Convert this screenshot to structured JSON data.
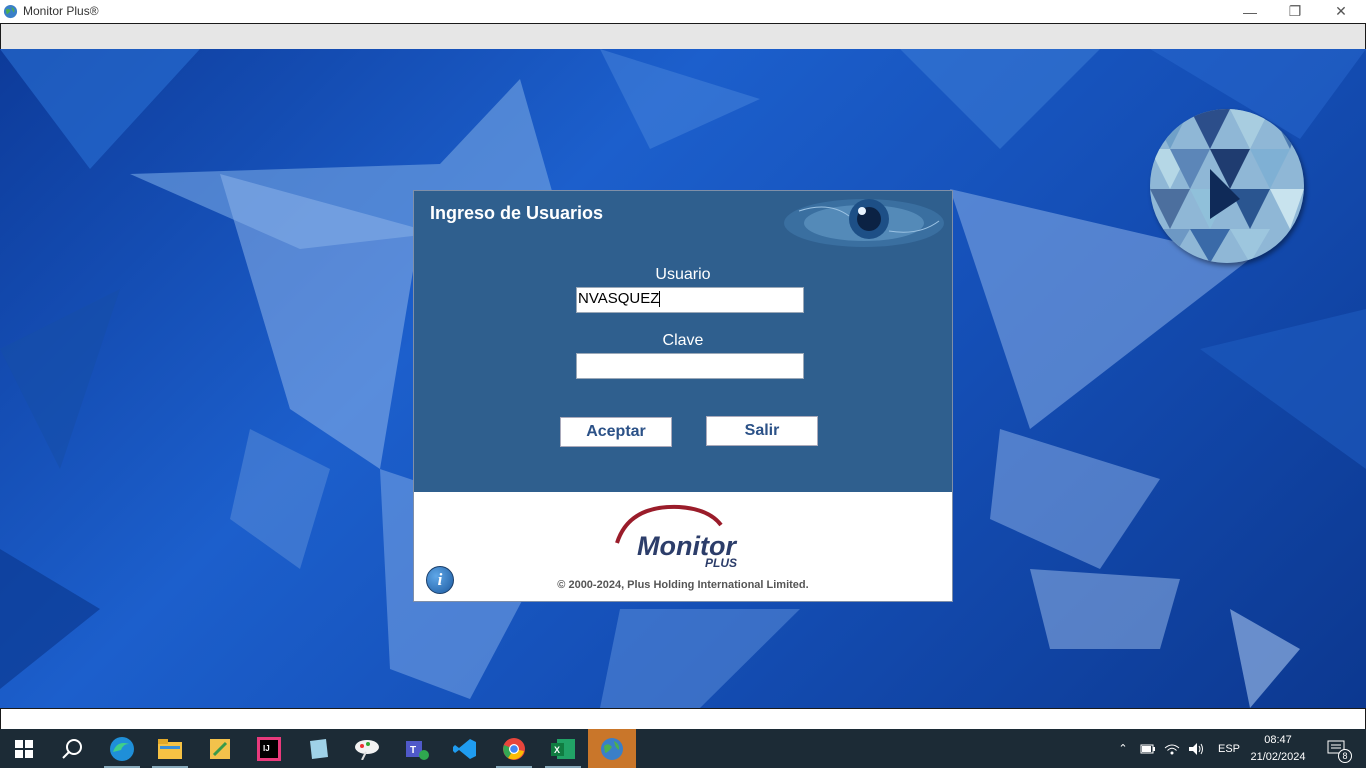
{
  "window": {
    "title": "Monitor Plus®",
    "minimize": "—",
    "restore": "❐",
    "close": "✕"
  },
  "dialog": {
    "title": "Ingreso de Usuarios",
    "usuario_label": "Usuario",
    "usuario_value": "NVASQUEZ",
    "clave_label": "Clave",
    "clave_value": "",
    "accept_label": "Aceptar",
    "exit_label": "Salir",
    "info_icon_glyph": "i",
    "brand_name": "Monitor",
    "brand_sub": "PLUS",
    "copyright": "© 2000-2024, Plus Holding International Limited."
  },
  "taskbar": {
    "items": [
      "start-icon",
      "search-icon",
      "edge-icon",
      "file-explorer-icon",
      "app-icon",
      "intellij-icon",
      "notes-icon",
      "paint-icon",
      "teams-icon",
      "vscode-icon",
      "chrome-icon",
      "excel-icon",
      "monitor-plus-icon"
    ],
    "tray": {
      "language": "ESP",
      "time": "08:47",
      "date": "21/02/2024",
      "notifications": "8"
    }
  },
  "colors": {
    "dialog_bg": "#2f5f8e",
    "button_text": "#2b5187",
    "active_task": "#c9762a"
  }
}
